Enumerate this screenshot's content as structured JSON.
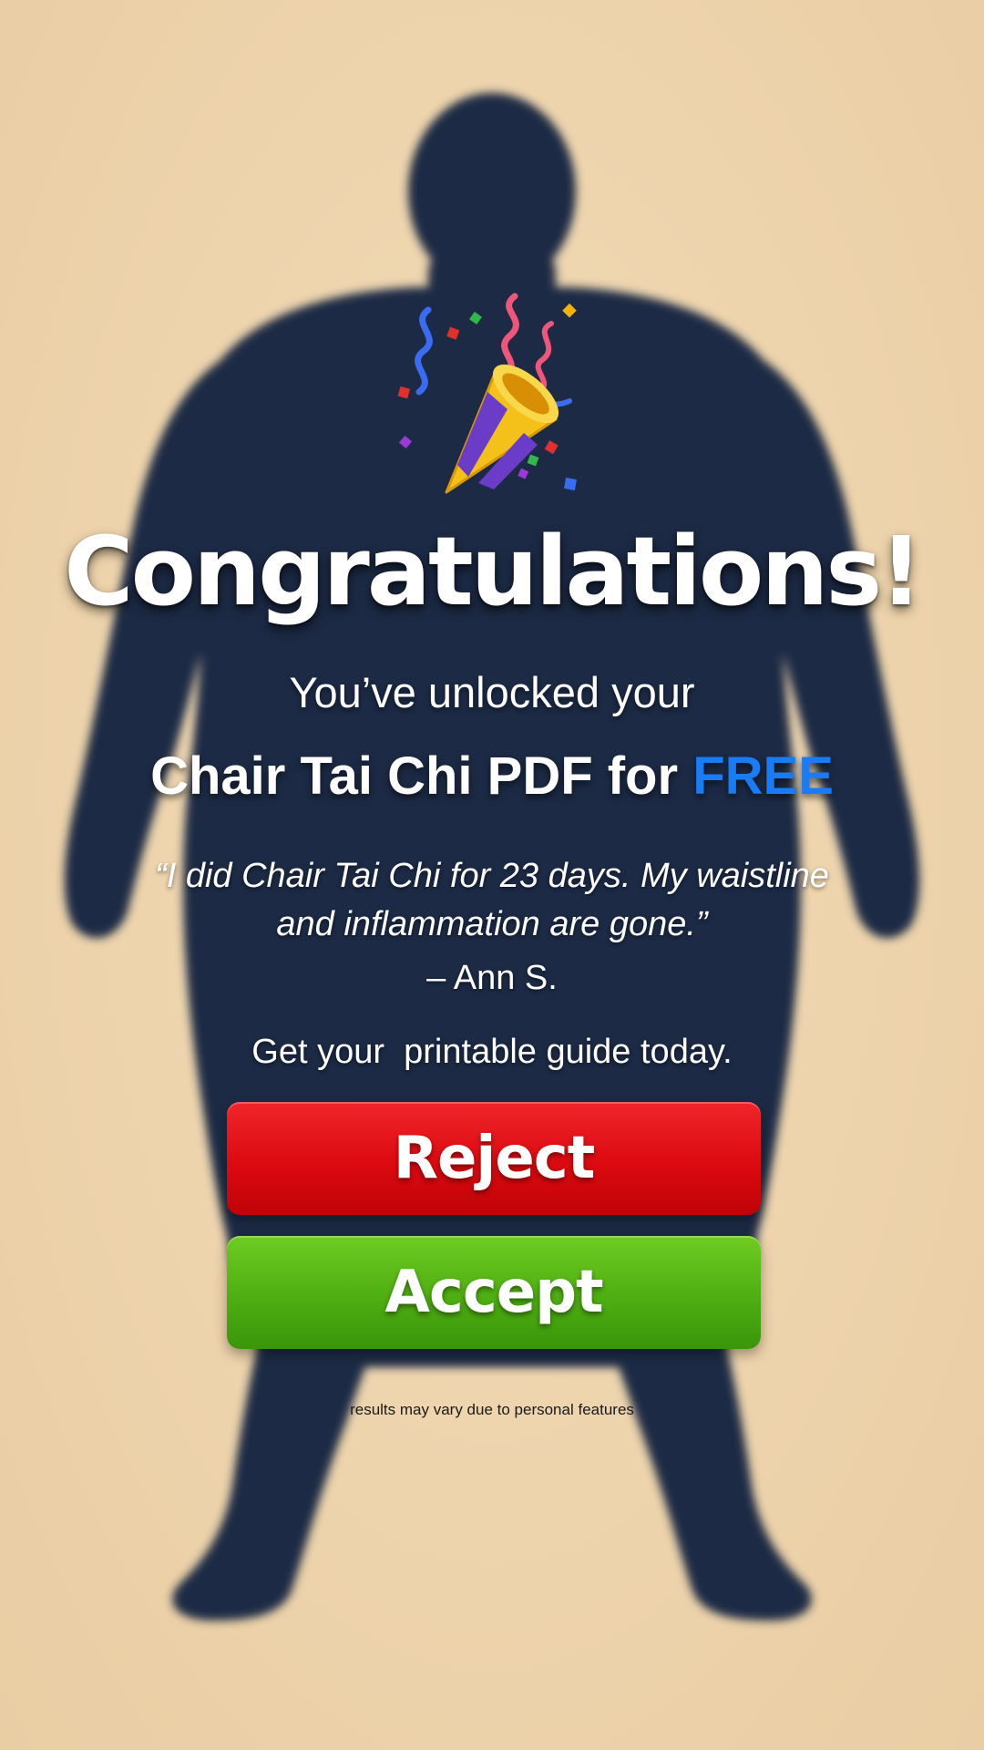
{
  "headline": {
    "title": "Congratulations!",
    "subtitle": "You’ve unlocked your",
    "offer_main": "Chair Tai Chi PDF for ",
    "offer_highlight": "FREE"
  },
  "testimonial": {
    "quote": "“I did Chair Tai Chi for 23 days. My waistline and inflammation are gone.”",
    "author": "– Ann S."
  },
  "cta": {
    "text": "Get your  printable guide today.",
    "reject_label": "Reject",
    "accept_label": "Accept"
  },
  "disclaimer": "results may vary due to personal features",
  "icons": {
    "celebration": "party-popper-icon",
    "background": "person-silhouette"
  },
  "colors": {
    "background": "#efd6b0",
    "silhouette": "#1d2c45",
    "highlight": "#1a7cf5",
    "reject": "#dc0a10",
    "accept": "#4eae12",
    "text": "#ffffff"
  }
}
